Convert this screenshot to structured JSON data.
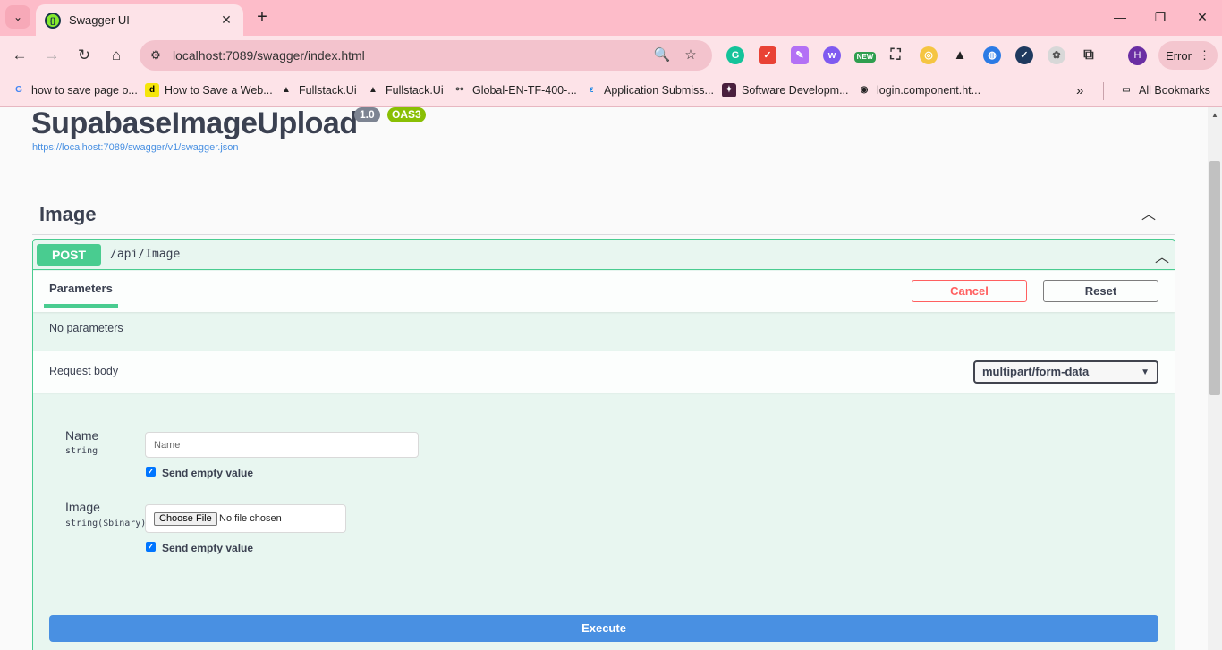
{
  "browser": {
    "tab_title": "Swagger UI",
    "url": "localhost:7089/swagger/index.html",
    "profile_initial": "H",
    "error_label": "Error",
    "bookmarks": [
      "how to save page o...",
      "How to Save a Web...",
      "Fullstack.Ui",
      "Fullstack.Ui",
      "Global-EN-TF-400-...",
      "Application Submiss...",
      "Software Developm...",
      "login.component.ht..."
    ],
    "all_bookmarks": "All Bookmarks",
    "new_badge": "NEW"
  },
  "swagger": {
    "title": "SupabaseImageUpload",
    "version": "1.0",
    "oas": "OAS3",
    "spec_url": "https://localhost:7089/swagger/v1/swagger.json",
    "tag": "Image",
    "operation": {
      "method": "POST",
      "path": "/api/Image",
      "params_tab": "Parameters",
      "cancel": "Cancel",
      "reset": "Reset",
      "no_params": "No parameters",
      "request_body": "Request body",
      "content_type": "multipart/form-data",
      "fields": [
        {
          "name": "Name",
          "type": "string",
          "placeholder": "Name",
          "send_empty": "Send empty value"
        },
        {
          "name": "Image",
          "type": "string($binary)",
          "file_button": "Choose File",
          "file_status": "No file chosen",
          "send_empty": "Send empty value"
        }
      ],
      "execute": "Execute"
    }
  }
}
